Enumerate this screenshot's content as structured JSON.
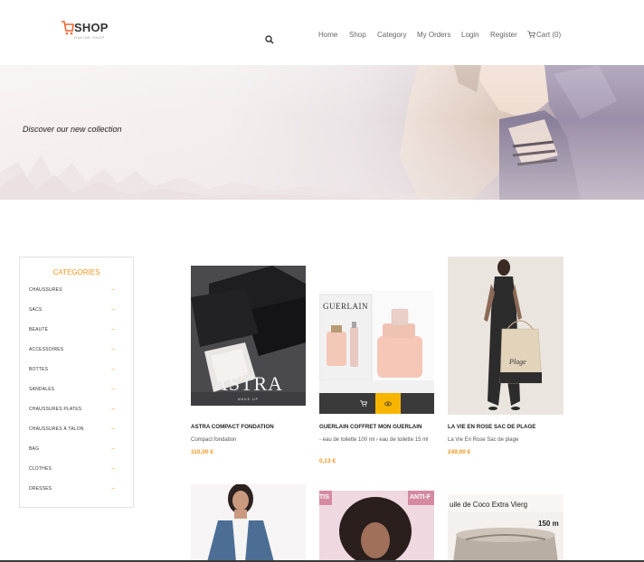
{
  "logo": {
    "text": "SHOP",
    "sub": "ONLINE SHOP"
  },
  "nav": {
    "home": "Home",
    "shop": "Shop",
    "category": "Category",
    "orders": "My Orders",
    "login": "Login",
    "register": "Register",
    "cart": "Cart (0)"
  },
  "hero": {
    "text": "Discover our new collection"
  },
  "sidebar": {
    "title": "CATEGORIES",
    "items": [
      {
        "label": "CHAUSSURES",
        "dash": "–"
      },
      {
        "label": "SACS",
        "dash": "–"
      },
      {
        "label": "BEAUTÉ",
        "dash": "–"
      },
      {
        "label": "ACCESSOIRES",
        "dash": "–"
      },
      {
        "label": "BOTTES",
        "dash": "–"
      },
      {
        "label": "SANDALES",
        "dash": "–"
      },
      {
        "label": "CHAUSSURES PLATES",
        "dash": "–"
      },
      {
        "label": "CHAUSSURES À TALON",
        "dash": "–"
      },
      {
        "label": "BAG",
        "dash": "–"
      },
      {
        "label": "CLOTHES",
        "dash": "–"
      },
      {
        "label": "DRESSES",
        "dash": "–"
      }
    ]
  },
  "products": [
    {
      "name": "ASTRA COMPACT FONDATION",
      "desc": "Compact fondation",
      "price": "110,00 €",
      "img_text": "ASTRA",
      "img_sub": "MAKE-UP"
    },
    {
      "name": "GUERLAIN COFFRET MON GUERLAIN",
      "desc": "- eau de toilette 100 ml › eau de toilette 15 ml",
      "price": "0,13 €",
      "img_text": "GUERLAIN"
    },
    {
      "name": "LA VIE EN ROSE SAC DE PLAGE",
      "desc": "La Vie En Rose Sac de plage",
      "price": "249,00 €",
      "img_text": "Plage"
    }
  ],
  "row2": {
    "label_b": "TIS",
    "label_b2": "ANTI-F",
    "label_c": "uile de Coco Extra Vierg",
    "label_c2": "150 m"
  },
  "colors": {
    "accent": "#f7941d",
    "view_button": "#f7b500",
    "dark": "#3a3a3a"
  }
}
